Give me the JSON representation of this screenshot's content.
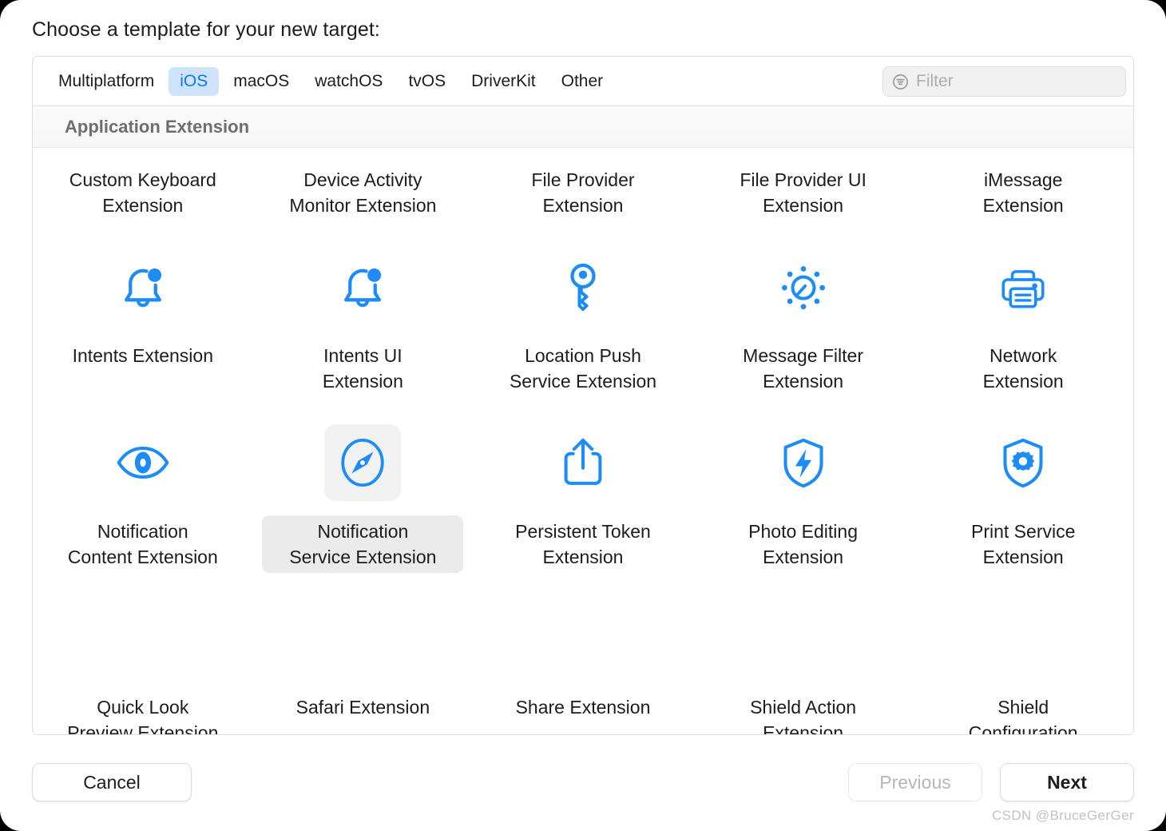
{
  "window": {
    "prompt": "Choose a template for your new target:"
  },
  "tabs": [
    {
      "label": "Multiplatform",
      "selected": false
    },
    {
      "label": "iOS",
      "selected": true
    },
    {
      "label": "macOS",
      "selected": false
    },
    {
      "label": "watchOS",
      "selected": false
    },
    {
      "label": "tvOS",
      "selected": false
    },
    {
      "label": "DriverKit",
      "selected": false
    },
    {
      "label": "Other",
      "selected": false
    }
  ],
  "filter": {
    "placeholder": "Filter",
    "value": "",
    "icon": "filter-icon"
  },
  "section": {
    "title": "Application Extension"
  },
  "templates": [
    {
      "label": "Custom Keyboard\nExtension",
      "icon": "siri-infinity-icon",
      "selected": false
    },
    {
      "label": "Device Activity\nMonitor Extension",
      "icon": "siri-infinity-icon",
      "selected": false
    },
    {
      "label": "File Provider\nExtension",
      "icon": "location-arrow-icon",
      "selected": false
    },
    {
      "label": "File Provider UI\nExtension",
      "icon": "trash-x-icon",
      "selected": false
    },
    {
      "label": "iMessage\nExtension",
      "icon": "globe-icon",
      "selected": false
    },
    {
      "label": "Intents Extension",
      "icon": "bell-badge-icon",
      "selected": false
    },
    {
      "label": "Intents UI\nExtension",
      "icon": "bell-badge-icon",
      "selected": false
    },
    {
      "label": "Location Push\nService Extension",
      "icon": "key-icon",
      "selected": false
    },
    {
      "label": "Message Filter\nExtension",
      "icon": "brightness-icon",
      "selected": false
    },
    {
      "label": "Network\nExtension",
      "icon": "printer-icon",
      "selected": false
    },
    {
      "label": "Notification\nContent Extension",
      "icon": "eye-icon",
      "selected": false
    },
    {
      "label": "Notification\nService Extension",
      "icon": "compass-icon",
      "selected": true
    },
    {
      "label": "Persistent Token\nExtension",
      "icon": "share-icon",
      "selected": false
    },
    {
      "label": "Photo Editing\nExtension",
      "icon": "shield-bolt-icon",
      "selected": false
    },
    {
      "label": "Print Service\nExtension",
      "icon": "shield-gear-icon",
      "selected": false
    },
    {
      "label": "Quick Look\nPreview Extension",
      "icon": "blank-icon",
      "selected": false
    },
    {
      "label": "Safari Extension",
      "icon": "blank-icon",
      "selected": false
    },
    {
      "label": "Share Extension",
      "icon": "blank-icon",
      "selected": false
    },
    {
      "label": "Shield Action\nExtension",
      "icon": "blank-icon",
      "selected": false
    },
    {
      "label": "Shield\nConfiguration",
      "icon": "blank-icon",
      "selected": false
    }
  ],
  "footer": {
    "cancel": "Cancel",
    "previous": "Previous",
    "next": "Next"
  },
  "watermark": "CSDN @BruceGerGer",
  "colors": {
    "accent": "#1c8cf8",
    "tab_selected_bg": "#cfe3fd",
    "tab_selected_text": "#0a7bfb",
    "selection_bg": "#ebebeb",
    "text": "#1c1c1e",
    "muted": "#6e6e6e"
  }
}
